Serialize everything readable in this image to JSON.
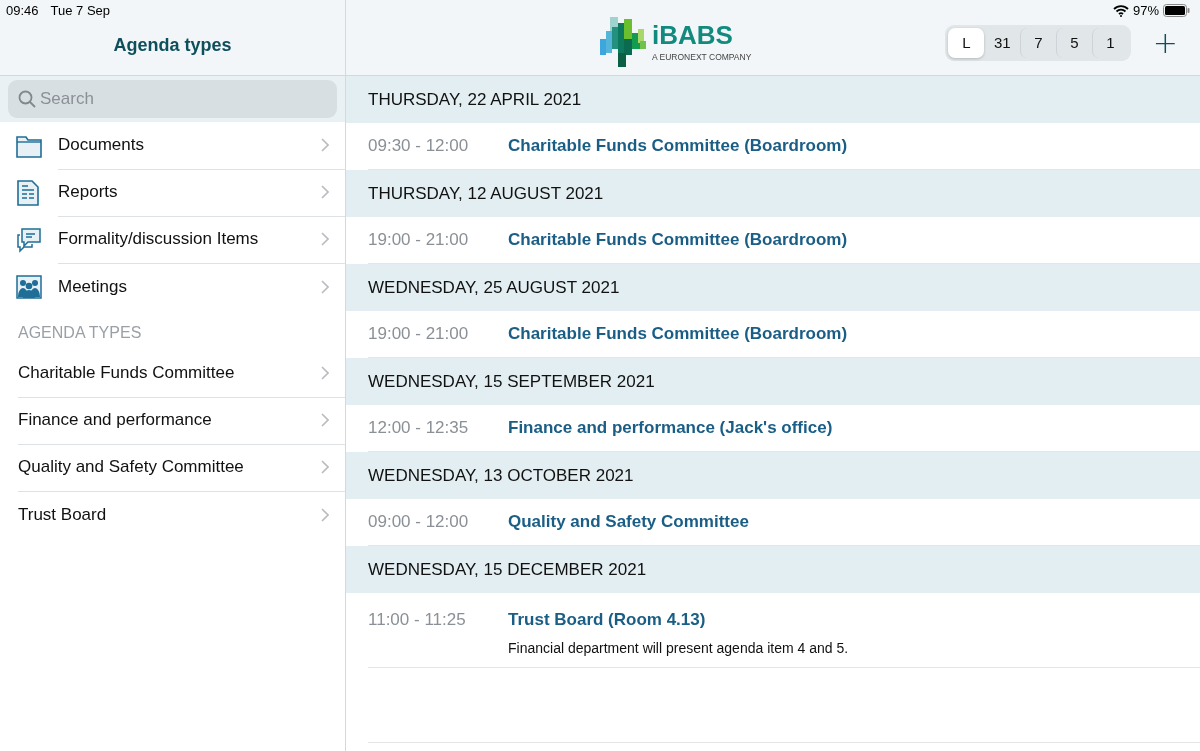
{
  "status_bar": {
    "time": "09:46",
    "date": "Tue 7 Sep",
    "battery": "97%"
  },
  "sidebar": {
    "title": "Agenda types",
    "search": {
      "placeholder": "Search"
    },
    "items": [
      {
        "label": "Documents",
        "kind": "folder"
      },
      {
        "label": "Reports",
        "kind": "report"
      },
      {
        "label": "Formality/discussion Items",
        "kind": "chat"
      },
      {
        "label": "Meetings",
        "kind": "people"
      }
    ],
    "section_title": "AGENDA TYPES",
    "agenda_types": [
      {
        "label": "Charitable Funds Committee"
      },
      {
        "label": "Finance and performance"
      },
      {
        "label": "Quality and Safety Committee"
      },
      {
        "label": "Trust Board"
      }
    ]
  },
  "header": {
    "logo": {
      "name": "iBABS",
      "tagline": "A EURONEXT COMPANY"
    },
    "view_segments": [
      {
        "label": "L",
        "selected": true
      },
      {
        "label": "31",
        "selected": false
      },
      {
        "label": "7",
        "selected": false
      },
      {
        "label": "5",
        "selected": false
      },
      {
        "label": "1",
        "selected": false
      }
    ],
    "add_button": "+"
  },
  "agenda": [
    {
      "date": "THURSDAY, 22 APRIL 2021",
      "events": [
        {
          "time": "09:30 - 12:00",
          "title": "Charitable Funds Committee (Boardroom)"
        }
      ]
    },
    {
      "date": "THURSDAY, 12 AUGUST 2021",
      "events": [
        {
          "time": "19:00 - 21:00",
          "title": "Charitable Funds Committee (Boardroom)"
        }
      ]
    },
    {
      "date": "WEDNESDAY, 25 AUGUST 2021",
      "events": [
        {
          "time": "19:00 - 21:00",
          "title": "Charitable Funds Committee (Boardroom)"
        }
      ]
    },
    {
      "date": "WEDNESDAY, 15 SEPTEMBER 2021",
      "events": [
        {
          "time": "12:00 - 12:35",
          "title": "Finance and performance (Jack's office)"
        }
      ]
    },
    {
      "date": "WEDNESDAY, 13 OCTOBER 2021",
      "events": [
        {
          "time": "09:00 - 12:00",
          "title": "Quality and Safety Committee"
        }
      ]
    },
    {
      "date": "WEDNESDAY, 15 DECEMBER 2021",
      "events": [
        {
          "time": "11:00 - 11:25",
          "title": "Trust Board (Room 4.13)",
          "note": "Financial department will present agenda item 4 and 5."
        }
      ]
    }
  ]
}
